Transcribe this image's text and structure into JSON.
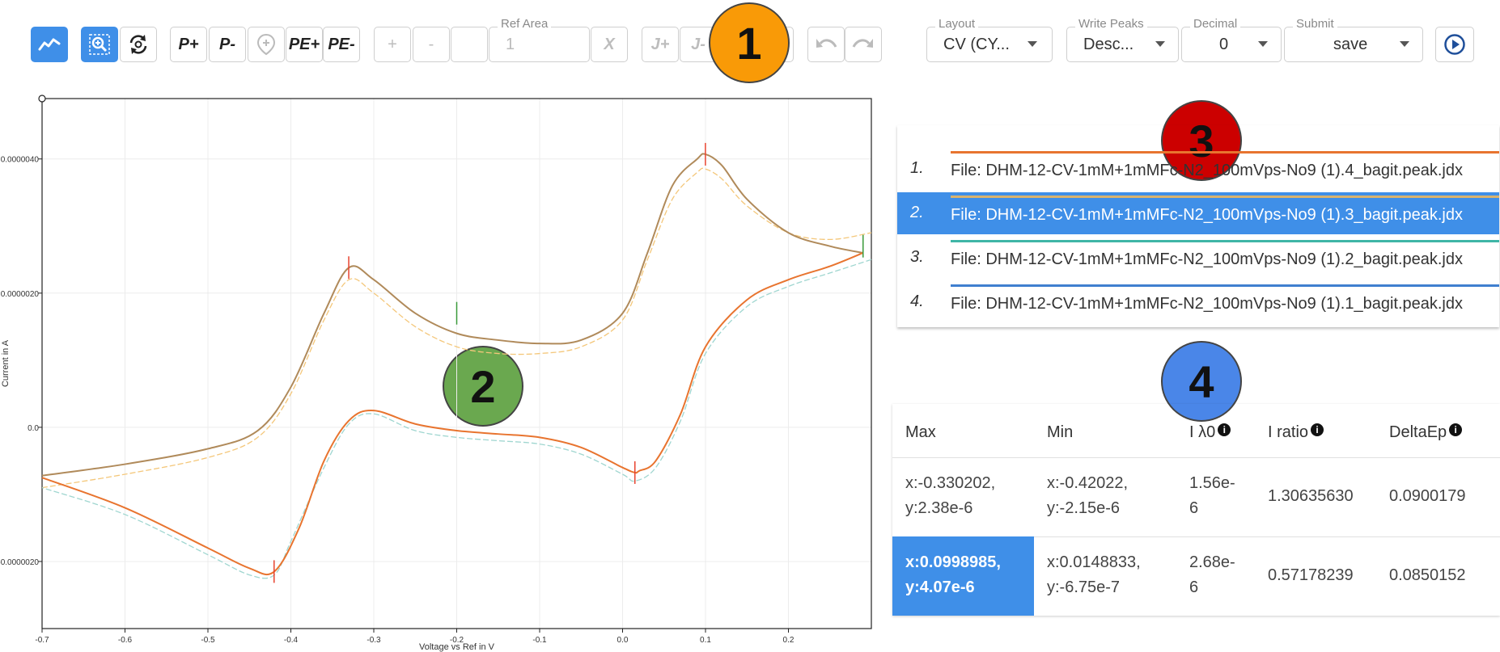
{
  "toolbar": {
    "peak_plus": "P+",
    "peak_minus": "P-",
    "pe_plus": "PE+",
    "pe_minus": "PE-",
    "int_plus": "+",
    "int_minus": "-",
    "ref_area_label": "Ref Area",
    "ref_area_value": "1",
    "x_label": "X",
    "j_plus": "J+",
    "j_minus": "J-",
    "layout_label": "Layout",
    "layout_value": "CV (CY...",
    "write_peaks_label": "Write Peaks",
    "write_peaks_value": "Desc...",
    "decimal_label": "Decimal",
    "decimal_value": "0",
    "submit_label": "Submit",
    "submit_value": "save"
  },
  "badges": [
    "1",
    "2",
    "3",
    "4"
  ],
  "colors": {
    "accent": "#3f8fe8",
    "badge1": "#f99a07",
    "badge2": "#6aa84f",
    "badge3": "#cc0000",
    "badge4": "#4a86e8",
    "series_orange": "#e8742f",
    "series_tan": "#b08a5a",
    "series_yellow": "#f4c77a",
    "series_teal": "#9fd6d0",
    "marker_red": "#e8432f",
    "marker_green": "#3a9a3a"
  },
  "files": [
    {
      "num": "1.",
      "name": "File: DHM-12-CV-1mM+1mMFc-N2_100mVps-No9 (1).4_bagit.peak.jdx",
      "color": "#e8742f",
      "selected": false
    },
    {
      "num": "2.",
      "name": "File: DHM-12-CV-1mM+1mMFc-N2_100mVps-No9 (1).3_bagit.peak.jdx",
      "color": "#d9b36e",
      "selected": true
    },
    {
      "num": "3.",
      "name": "File: DHM-12-CV-1mM+1mMFc-N2_100mVps-No9 (1).2_bagit.peak.jdx",
      "color": "#3fb5a6",
      "selected": false
    },
    {
      "num": "4.",
      "name": "File: DHM-12-CV-1mM+1mMFc-N2_100mVps-No9 (1).1_bagit.peak.jdx",
      "color": "#3f7fcf",
      "selected": false
    }
  ],
  "table": {
    "headers": [
      "Max",
      "Min",
      "I λ0",
      "I ratio",
      "DeltaEp"
    ],
    "rows": [
      {
        "max1": "x:-0.330202,",
        "max2": "y:2.38e-6",
        "min1": "x:-0.42022,",
        "min2": "y:-2.15e-6",
        "il1": "1.56e-",
        "il2": "6",
        "ratio": "1.30635630",
        "delta": "0.0900179 "
      },
      {
        "max1": "x:0.0998985,",
        "max2": "y:4.07e-6",
        "min1": "x:0.0148833,",
        "min2": "y:-6.75e-7",
        "il1": "2.68e-",
        "il2": "6",
        "ratio": "0.57178239",
        "delta": "0.0850152"
      }
    ]
  },
  "chart_data": {
    "type": "line",
    "xlabel": "Voltage vs Ref in V",
    "ylabel": "Current in A",
    "xlim": [
      -0.7,
      0.3
    ],
    "ylim": [
      -3e-06,
      4.9e-06
    ],
    "x_ticks": [
      -0.7,
      -0.6,
      -0.5,
      -0.4,
      -0.3,
      -0.2,
      -0.1,
      0.0,
      0.1,
      0.2
    ],
    "x_tick_labels": [
      "-0.7",
      "-0.6",
      "-0.5",
      "-0.4",
      "-0.3",
      "-0.2",
      "-0.1",
      "0.0",
      "0.1",
      "0.2"
    ],
    "y_ticks": [
      -2e-06,
      0,
      2e-06,
      4e-06
    ],
    "y_tick_labels": [
      "-0.0000020",
      "0.0",
      "0.0000020",
      "0.0000040"
    ],
    "grid": true,
    "series": [
      {
        "color": "#b08a5a",
        "x": [
          -0.7,
          -0.6,
          -0.5,
          -0.44,
          -0.4,
          -0.36,
          -0.33,
          -0.3,
          -0.25,
          -0.2,
          -0.15,
          -0.1,
          -0.05,
          0.0,
          0.03,
          0.06,
          0.09,
          0.1,
          0.12,
          0.15,
          0.2,
          0.25,
          0.29
        ],
        "y": [
          -7.2e-07,
          -5.5e-07,
          -3.2e-07,
          -5e-08,
          6e-07,
          1.7e-06,
          2.38e-06,
          2.2e-06,
          1.7e-06,
          1.4e-06,
          1.3e-06,
          1.25e-06,
          1.3e-06,
          1.7e-06,
          2.6e-06,
          3.6e-06,
          4e-06,
          4.07e-06,
          3.9e-06,
          3.4e-06,
          2.9e-06,
          2.7e-06,
          2.6e-06
        ]
      },
      {
        "color": "#e8742f",
        "x": [
          0.29,
          0.25,
          0.2,
          0.15,
          0.1,
          0.07,
          0.04,
          0.02,
          0.0148833,
          0.0,
          -0.05,
          -0.1,
          -0.15,
          -0.2,
          -0.25,
          -0.3,
          -0.33,
          -0.36,
          -0.39,
          -0.42,
          -0.45,
          -0.5,
          -0.6,
          -0.7
        ],
        "y": [
          2.6e-06,
          2.4e-06,
          2.2e-06,
          1.9e-06,
          1.2e-06,
          2e-07,
          -5e-07,
          -6.5e-07,
          -6.75e-07,
          -6e-07,
          -3e-07,
          -1.5e-07,
          -1e-07,
          -5e-08,
          5e-08,
          2.5e-07,
          1e-07,
          -5e-07,
          -1.5e-06,
          -2.15e-06,
          -2.1e-06,
          -1.8e-06,
          -1.2e-06,
          -7.5e-07
        ]
      },
      {
        "color": "#f4c77a",
        "x": [
          -0.7,
          -0.6,
          -0.5,
          -0.44,
          -0.4,
          -0.36,
          -0.33,
          -0.3,
          -0.25,
          -0.2,
          -0.15,
          -0.1,
          -0.05,
          0.0,
          0.03,
          0.06,
          0.09,
          0.1,
          0.12,
          0.15,
          0.2,
          0.25,
          0.3
        ],
        "y": [
          -9e-07,
          -7e-07,
          -4.5e-07,
          -1.5e-07,
          5e-07,
          1.6e-06,
          2.2e-06,
          2e-06,
          1.5e-06,
          1.2e-06,
          1.1e-06,
          1.1e-06,
          1.2e-06,
          1.6e-06,
          2.5e-06,
          3.4e-06,
          3.8e-06,
          3.85e-06,
          3.7e-06,
          3.3e-06,
          2.9e-06,
          2.8e-06,
          2.9e-06
        ]
      },
      {
        "color": "#9fd6d0",
        "x": [
          0.3,
          0.25,
          0.2,
          0.15,
          0.1,
          0.07,
          0.04,
          0.015,
          0.0,
          -0.05,
          -0.1,
          -0.15,
          -0.2,
          -0.25,
          -0.3,
          -0.33,
          -0.36,
          -0.4,
          -0.42,
          -0.45,
          -0.5,
          -0.6,
          -0.7
        ],
        "y": [
          2.5e-06,
          2.3e-06,
          2.1e-06,
          1.8e-06,
          1.1e-06,
          1e-07,
          -6e-07,
          -8e-07,
          -7e-07,
          -4e-07,
          -2.5e-07,
          -2e-07,
          -1.5e-07,
          -5e-08,
          2e-07,
          5e-08,
          -6e-07,
          -1.7e-06,
          -2.2e-06,
          -2.2e-06,
          -1.9e-06,
          -1.3e-06,
          -9e-07
        ]
      }
    ],
    "markers": [
      {
        "x": -0.330202,
        "y": 2.38e-06,
        "color": "#e8432f"
      },
      {
        "x": 0.0998985,
        "y": 4.07e-06,
        "color": "#e8432f"
      },
      {
        "x": 0.0148833,
        "y": -6.75e-07,
        "color": "#e8432f"
      },
      {
        "x": -0.42022,
        "y": -2.15e-06,
        "color": "#e8432f"
      },
      {
        "x": -0.2,
        "y": 1.7e-06,
        "color": "#3a9a3a"
      },
      {
        "x": 0.29,
        "y": 2.7e-06,
        "color": "#3a9a3a"
      }
    ]
  }
}
